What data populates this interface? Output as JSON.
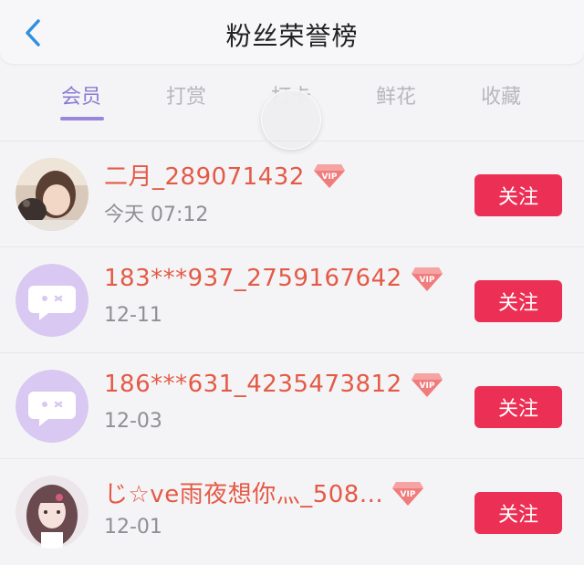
{
  "header": {
    "title": "粉丝荣誉榜"
  },
  "tabs": [
    {
      "label": "会员"
    },
    {
      "label": "打赏"
    },
    {
      "label": "打卡"
    },
    {
      "label": "鲜花"
    },
    {
      "label": "收藏"
    }
  ],
  "rows": [
    {
      "name": "二月_289071432",
      "date": "今天 07:12",
      "vip_label": "VIP",
      "follow_label": "关注",
      "avatar": "photo-girl-with-cat"
    },
    {
      "name": "183***937_2759167642",
      "date": "12-11",
      "vip_label": "VIP",
      "follow_label": "关注",
      "avatar": "default-chat-face"
    },
    {
      "name": "186***631_4235473812",
      "date": "12-03",
      "vip_label": "VIP",
      "follow_label": "关注",
      "avatar": "default-chat-face"
    },
    {
      "name": "じ☆ve雨夜想你灬_508...",
      "date": "12-01",
      "vip_label": "VIP",
      "follow_label": "关注",
      "avatar": "anime-girl"
    }
  ],
  "colors": {
    "accent_tab": "#8c7ad2",
    "name_text": "#e45a46",
    "follow_button": "#ec2f55",
    "default_avatar_bg": "#d8c8f2"
  },
  "icons": {
    "back": "chevron-left-icon",
    "vip": "vip-diamond-icon"
  }
}
